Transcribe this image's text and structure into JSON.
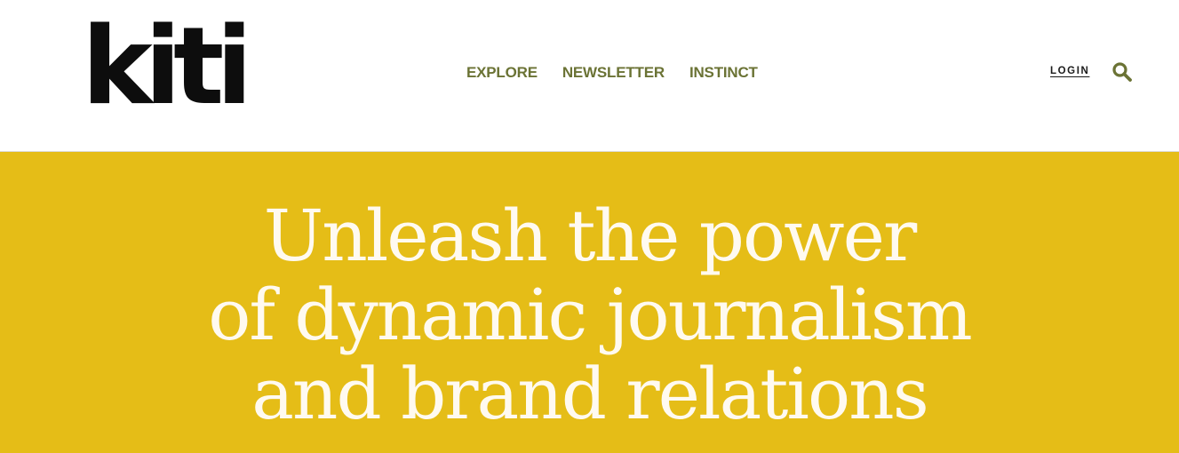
{
  "header": {
    "logo_text": "kiti",
    "nav": [
      {
        "label": "EXPLORE"
      },
      {
        "label": "NEWSLETTER"
      },
      {
        "label": "INSTINCT"
      }
    ],
    "login_label": "LOGIN",
    "search_icon": "search-icon"
  },
  "hero": {
    "headline_lines": [
      "Unleash the power",
      "of dynamic journalism",
      "and brand relations"
    ]
  },
  "colors": {
    "nav_text": "#6b7335",
    "hero_bg": "#e5bd17",
    "hero_text": "#fffaf0",
    "logo": "#0d0d0d"
  }
}
